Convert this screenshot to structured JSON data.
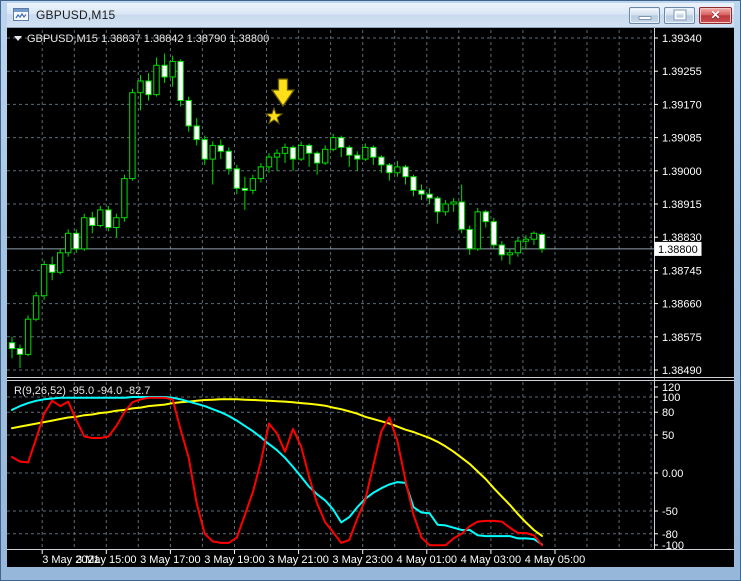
{
  "window": {
    "title": "GBPUSD,M15",
    "controls": {
      "minimize": "minimize",
      "restore": "restore",
      "close": "close"
    }
  },
  "header_readout": {
    "symbol_period": "GBPUSD,M15",
    "open": "1.38837",
    "high": "1.38842",
    "low": "1.38790",
    "close": "1.38800"
  },
  "indicator_readout": {
    "name": "R(9,26,52)",
    "values": [
      "-95.0",
      "-94.0",
      "-82.7"
    ]
  },
  "price_axis": {
    "labels": [
      "1.39340",
      "1.39255",
      "1.39170",
      "1.39085",
      "1.39000",
      "1.38915",
      "1.38830",
      "1.38745",
      "1.38660",
      "1.38575",
      "1.38490"
    ],
    "current_price_tag": "1.38800"
  },
  "indicator_axis": {
    "labels": [
      "120",
      "100",
      "80",
      "50",
      "0.00",
      "-50",
      "-80",
      "-100"
    ]
  },
  "time_axis": {
    "labels": [
      "3 May 2021",
      "3 May 15:00",
      "3 May 17:00",
      "3 May 19:00",
      "3 May 21:00",
      "3 May 23:00",
      "4 May 01:00",
      "4 May 03:00",
      "4 May 05:00"
    ]
  },
  "annotations": {
    "arrow": {
      "type": "down-arrow",
      "color": "#ffdf1a"
    },
    "star": {
      "type": "star",
      "color": "#ffdf1a"
    }
  },
  "colors": {
    "background": "#000000",
    "grid": "#5c6b76",
    "candle_outline": "#00dd00",
    "bull_fill": "#000000",
    "bear_fill": "#ffffff",
    "bid_line": "#90a0ae",
    "axis_text": "#ffffff",
    "separator": "#ccd2d7",
    "r9": "#ff0000",
    "r26": "#00ffff",
    "r52": "#ffff00",
    "annotation_fill": "#ffdf1a",
    "annotation_stroke": "#6a5d00"
  },
  "chart_data": {
    "type": "candlestick",
    "symbol": "GBPUSD",
    "period": "M15",
    "price_range": {
      "min": 1.3849,
      "max": 1.3934
    },
    "price_gridlines": [
      1.3934,
      1.39255,
      1.3917,
      1.39085,
      1.39,
      1.38915,
      1.3883,
      1.38745,
      1.3866,
      1.38575,
      1.3849
    ],
    "current_price": 1.388,
    "candles_ohlc": [
      [
        1.3856,
        1.38575,
        1.3852,
        1.38545
      ],
      [
        1.38545,
        1.38555,
        1.38495,
        1.3853
      ],
      [
        1.3853,
        1.3863,
        1.38525,
        1.3862
      ],
      [
        1.3862,
        1.3869,
        1.38615,
        1.3868
      ],
      [
        1.3868,
        1.3877,
        1.3867,
        1.3876
      ],
      [
        1.3876,
        1.3878,
        1.3872,
        1.3874
      ],
      [
        1.3874,
        1.388,
        1.38735,
        1.3879
      ],
      [
        1.3879,
        1.3885,
        1.3878,
        1.3884
      ],
      [
        1.3884,
        1.3885,
        1.3879,
        1.388
      ],
      [
        1.388,
        1.3889,
        1.38795,
        1.3888
      ],
      [
        1.3888,
        1.38895,
        1.3884,
        1.3886
      ],
      [
        1.3886,
        1.3891,
        1.38855,
        1.389
      ],
      [
        1.389,
        1.3891,
        1.38845,
        1.38855
      ],
      [
        1.38855,
        1.3889,
        1.3883,
        1.3888
      ],
      [
        1.3888,
        1.3899,
        1.3887,
        1.3898
      ],
      [
        1.3898,
        1.3921,
        1.38975,
        1.392
      ],
      [
        1.392,
        1.39245,
        1.39155,
        1.3923
      ],
      [
        1.3923,
        1.3925,
        1.3918,
        1.39195
      ],
      [
        1.39195,
        1.3929,
        1.3919,
        1.3927
      ],
      [
        1.3927,
        1.393,
        1.39225,
        1.3924
      ],
      [
        1.3924,
        1.39295,
        1.39215,
        1.3928
      ],
      [
        1.3928,
        1.39285,
        1.39165,
        1.3918
      ],
      [
        1.3918,
        1.3919,
        1.391,
        1.39115
      ],
      [
        1.39115,
        1.39135,
        1.39065,
        1.3908
      ],
      [
        1.3908,
        1.3909,
        1.39015,
        1.3903
      ],
      [
        1.3903,
        1.39075,
        1.38965,
        1.39065
      ],
      [
        1.39065,
        1.3908,
        1.3903,
        1.3905
      ],
      [
        1.3905,
        1.3906,
        1.3899,
        1.39005
      ],
      [
        1.39005,
        1.39015,
        1.3894,
        1.38955
      ],
      [
        1.38955,
        1.38985,
        1.389,
        1.3895
      ],
      [
        1.3895,
        1.3899,
        1.3894,
        1.3898
      ],
      [
        1.3898,
        1.3902,
        1.3897,
        1.3901
      ],
      [
        1.3901,
        1.39045,
        1.38995,
        1.39035
      ],
      [
        1.39035,
        1.39055,
        1.39,
        1.39045
      ],
      [
        1.39045,
        1.3907,
        1.3902,
        1.3906
      ],
      [
        1.3906,
        1.39065,
        1.39,
        1.3903
      ],
      [
        1.3903,
        1.39075,
        1.39025,
        1.39065
      ],
      [
        1.39065,
        1.3907,
        1.3901,
        1.39045
      ],
      [
        1.39045,
        1.3905,
        1.3899,
        1.3902
      ],
      [
        1.3902,
        1.39065,
        1.39015,
        1.39055
      ],
      [
        1.39055,
        1.39095,
        1.3905,
        1.39085
      ],
      [
        1.39085,
        1.3909,
        1.39035,
        1.3906
      ],
      [
        1.3906,
        1.39065,
        1.3901,
        1.3904
      ],
      [
        1.3904,
        1.3905,
        1.39,
        1.3903
      ],
      [
        1.3903,
        1.3907,
        1.39025,
        1.3906
      ],
      [
        1.3906,
        1.39065,
        1.39015,
        1.39035
      ],
      [
        1.39035,
        1.3904,
        1.38995,
        1.39015
      ],
      [
        1.39015,
        1.3902,
        1.38975,
        1.38995
      ],
      [
        1.38995,
        1.39025,
        1.38985,
        1.3901
      ],
      [
        1.3901,
        1.39015,
        1.38965,
        1.38985
      ],
      [
        1.38985,
        1.3899,
        1.38935,
        1.3895
      ],
      [
        1.3895,
        1.38965,
        1.38925,
        1.3894
      ],
      [
        1.3894,
        1.38955,
        1.38915,
        1.3893
      ],
      [
        1.3893,
        1.38935,
        1.38865,
        1.38895
      ],
      [
        1.38895,
        1.38925,
        1.38885,
        1.38915
      ],
      [
        1.38915,
        1.3893,
        1.38895,
        1.3892
      ],
      [
        1.3892,
        1.38965,
        1.3884,
        1.3885
      ],
      [
        1.3885,
        1.3886,
        1.38785,
        1.388
      ],
      [
        1.388,
        1.38905,
        1.38795,
        1.38895
      ],
      [
        1.38895,
        1.389,
        1.38855,
        1.3887
      ],
      [
        1.3887,
        1.3888,
        1.388,
        1.3881
      ],
      [
        1.3881,
        1.3882,
        1.3877,
        1.38785
      ],
      [
        1.38785,
        1.388,
        1.3876,
        1.3879
      ],
      [
        1.3879,
        1.3883,
        1.3878,
        1.3882
      ],
      [
        1.3882,
        1.38835,
        1.388,
        1.38825
      ],
      [
        1.38825,
        1.38845,
        1.3881,
        1.3884
      ],
      [
        1.38837,
        1.38842,
        1.3879,
        1.388
      ]
    ],
    "annotation_candle_index": 33,
    "indicator": {
      "name": "R(9,26,52)",
      "range": [
        -100,
        120
      ],
      "gridlines": [
        100,
        80,
        50,
        0,
        -50,
        -80
      ],
      "series": [
        {
          "name": "R52",
          "color_key": "r52",
          "values": [
            59,
            61,
            63,
            65,
            67,
            69,
            71,
            73,
            74,
            76,
            77,
            79,
            80,
            82,
            83,
            85,
            86,
            88,
            89,
            90,
            92,
            93,
            94,
            95,
            96,
            96.5,
            97,
            97,
            97,
            96.5,
            96,
            95.5,
            95,
            94.5,
            94,
            93,
            92,
            91,
            90,
            88.5,
            86,
            84,
            81,
            78,
            74,
            71,
            68,
            65,
            61,
            57,
            54,
            50,
            46,
            41,
            35,
            28,
            20,
            12,
            2,
            -8,
            -20,
            -31,
            -42,
            -54,
            -65,
            -75,
            -82.7
          ]
        },
        {
          "name": "R26",
          "color_key": "r26",
          "values": [
            83,
            88,
            92,
            95,
            97,
            98,
            99,
            99,
            99,
            99,
            99,
            99,
            99,
            99,
            99,
            100,
            100,
            100,
            100,
            100,
            99,
            97,
            94,
            91,
            88,
            84,
            80,
            75,
            69,
            62,
            55,
            47,
            38,
            30,
            20,
            8,
            -5,
            -18,
            -28,
            -36,
            -48,
            -65,
            -58,
            -45,
            -34,
            -26,
            -20,
            -15,
            -12,
            -13,
            -45,
            -52,
            -53,
            -68,
            -69,
            -72,
            -75,
            -75,
            -82,
            -83,
            -83,
            -83,
            -83,
            -86,
            -86,
            -87,
            -94
          ]
        },
        {
          "name": "R9",
          "color_key": "r9",
          "values": [
            21,
            15,
            14,
            45,
            78,
            95,
            88,
            94,
            70,
            48,
            46,
            46,
            48,
            62,
            80,
            93,
            97,
            99,
            99,
            99,
            97,
            57,
            20,
            -40,
            -80,
            -90,
            -92,
            -92,
            -85,
            -55,
            -25,
            15,
            65,
            52,
            28,
            58,
            35,
            -5,
            -40,
            -65,
            -78,
            -92,
            -88,
            -60,
            -35,
            10,
            55,
            73,
            42,
            -10,
            -55,
            -85,
            -95,
            -95,
            -95,
            -86,
            -80,
            -70,
            -64,
            -63,
            -63,
            -64,
            -72,
            -79,
            -79,
            -82,
            -95
          ]
        }
      ]
    }
  }
}
